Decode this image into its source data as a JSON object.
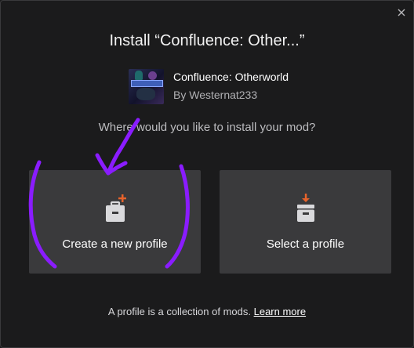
{
  "dialog": {
    "title": "Install “Confluence: Other...”",
    "close_icon": "close-icon"
  },
  "mod": {
    "name": "Confluence: Otherworld",
    "author": "By Westernat233"
  },
  "question": "Where would you like to install your mod?",
  "options": [
    {
      "label": "Create a new profile",
      "icon": "new-profile-icon"
    },
    {
      "label": "Select a profile",
      "icon": "select-profile-icon"
    }
  ],
  "footer": {
    "text": "A profile is a collection of mods.",
    "link": "Learn more"
  },
  "colors": {
    "background": "#1b1b1c",
    "card": "#3a3a3c",
    "accent": "#e8632b",
    "annotation": "#8a1cff"
  }
}
